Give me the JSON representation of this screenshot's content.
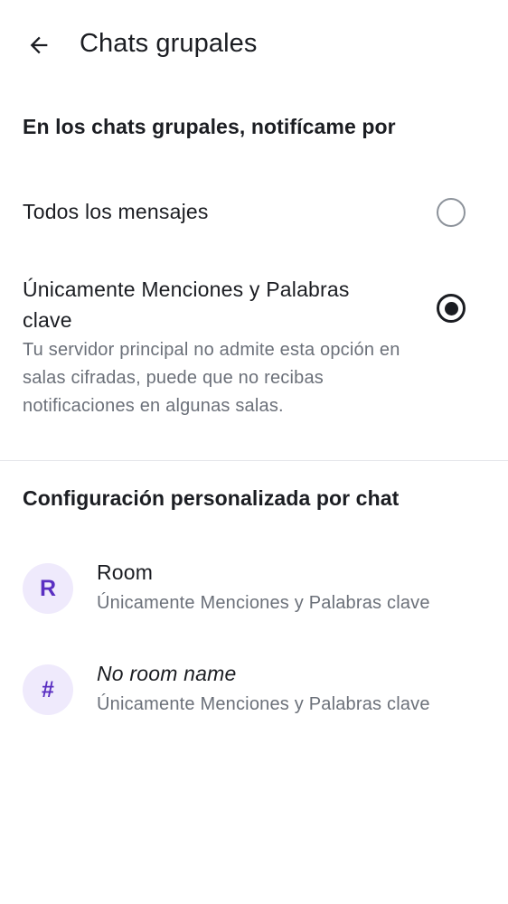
{
  "header": {
    "back_icon": "arrow-left-icon",
    "title": "Chats grupales"
  },
  "notify_section": {
    "title": "En los chats grupales, notifícame por",
    "options": [
      {
        "label": "Todos los mensajes",
        "selected": false
      },
      {
        "label": "Únicamente Menciones y Palabras clave",
        "description": "Tu servidor principal no admite esta opción en salas cifradas, puede que no recibas notificaciones en algunas salas.",
        "selected": true
      }
    ]
  },
  "custom_section": {
    "title": "Configuración personalizada por chat",
    "rooms": [
      {
        "avatar": "R",
        "name": "Room",
        "setting": "Únicamente Menciones y Palabras clave"
      },
      {
        "avatar": "#",
        "name": "No room name",
        "setting": "Únicamente Menciones y Palabras clave"
      }
    ]
  },
  "colors": {
    "accent": "#5a2fc2",
    "avatar_bg": "#efeafc",
    "text_primary": "#1b1d22",
    "text_secondary": "#6b7079"
  }
}
